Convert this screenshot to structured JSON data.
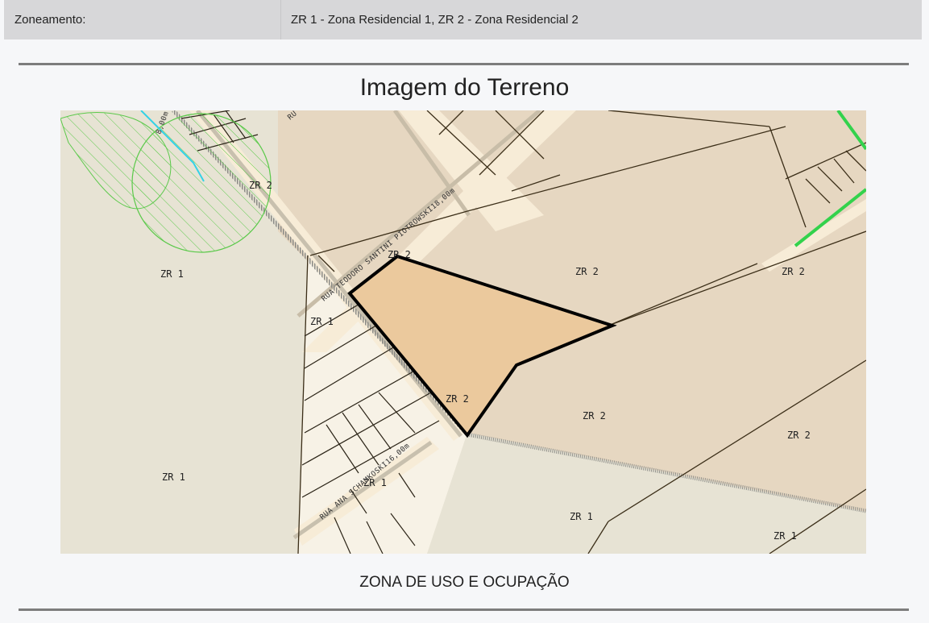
{
  "info": {
    "label": "Zoneamento:",
    "value": "ZR 1 - Zona Residencial 1, ZR 2 - Zona Residencial 2"
  },
  "section": {
    "title": "Imagem do Terreno",
    "caption": "ZONA DE USO E OCUPAÇÃO"
  },
  "map": {
    "zone_labels": [
      "ZR 2",
      "ZR 2",
      "ZR 1",
      "ZR 1",
      "ZR 2",
      "ZR 2",
      "ZR 2",
      "ZR 2",
      "ZR 2",
      "ZR 1",
      "ZR 1",
      "ZR 1",
      "ZR 1"
    ],
    "streets": {
      "top": "RUA TEODORO SANTINI PIOTROWSKI18,00m",
      "bottom": "RUA ANA SCHAMKOSKI16,00m",
      "corner": "8,00m",
      "corner_top": "RU"
    },
    "colors": {
      "plot_fill": "#ebc99d",
      "plot_stroke": "#000000",
      "zr2_fill": "#e6d7c1",
      "zr1_fill": "#e7e3d4",
      "road_fill": "#f7ecd7",
      "hatch": "#5bc94a",
      "water": "#34d2e6",
      "green_line": "#33d24c"
    }
  }
}
